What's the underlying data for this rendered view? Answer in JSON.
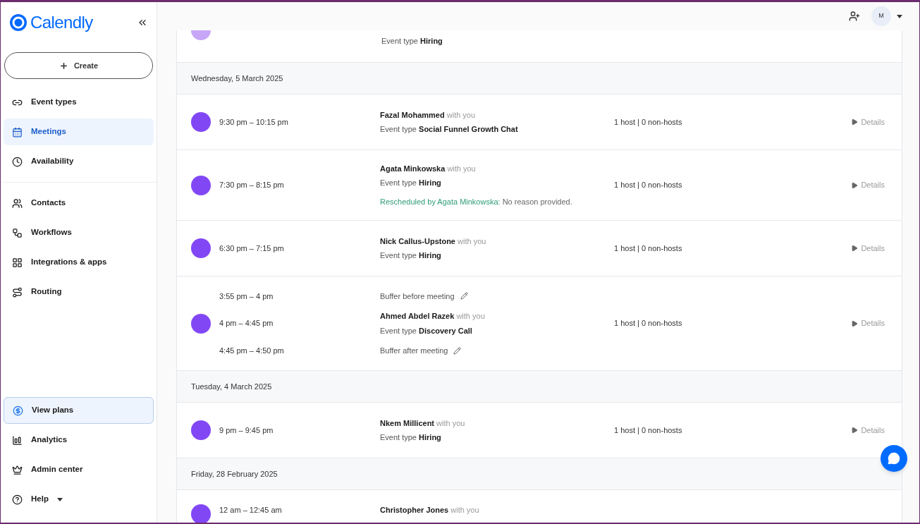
{
  "sidebar": {
    "logo": "Calendly",
    "create_button": "Create",
    "groups": [
      [
        {
          "label": "Event types",
          "selected": false
        },
        {
          "label": "Meetings",
          "selected": true
        },
        {
          "label": "Availability",
          "selected": false
        }
      ],
      [
        {
          "label": "Contacts",
          "selected": false
        },
        {
          "label": "Workflows",
          "selected": false
        },
        {
          "label": "Integrations & apps",
          "selected": false
        },
        {
          "label": "Routing",
          "selected": false
        }
      ]
    ],
    "view_plans": "View plans",
    "bottom_items": [
      {
        "label": "Analytics",
        "selected": false,
        "dropdown": false
      },
      {
        "label": "Admin center",
        "selected": false,
        "dropdown": false
      },
      {
        "label": "Help",
        "selected": false,
        "dropdown": true
      }
    ]
  },
  "header": {
    "avatar": "M"
  },
  "meetings": [
    {
      "kind": "partial",
      "event_label": "Event type",
      "event_type": "Hiring"
    },
    {
      "kind": "date",
      "label": "Wednesday, 5 March 2025"
    },
    {
      "kind": "meeting",
      "time": "9:30 pm – 10:15 pm",
      "invitee": "Fazal Mohammed",
      "with": "with you",
      "event_label": "Event type",
      "event_type": "Social Funnel Growth Chat",
      "hosts": "1 host | 0 non-hosts",
      "details": "Details"
    },
    {
      "kind": "meeting",
      "time": "7:30 pm – 8:15 pm",
      "invitee": "Agata Minkowska",
      "with": "with you",
      "event_label": "Event type",
      "event_type": "Hiring",
      "note_label": "Rescheduled by Agata Minkowska:",
      "note_text": "No reason provided.",
      "hosts": "1 host | 0 non-hosts",
      "details": "Details"
    },
    {
      "kind": "meeting",
      "time": "6:30 pm – 7:15 pm",
      "invitee": "Nick Callus-Upstone",
      "with": "with you",
      "event_label": "Event type",
      "event_type": "Hiring",
      "hosts": "1 host | 0 non-hosts",
      "details": "Details"
    },
    {
      "kind": "meeting",
      "time": "4 pm – 4:45 pm",
      "invitee": "Ahmed Abdel Razek",
      "with": "with you",
      "event_label": "Event type",
      "event_type": "Discovery Call",
      "hosts": "1 host | 0 non-hosts",
      "details": "Details",
      "buffer_before": {
        "time": "3:55 pm – 4 pm",
        "label": "Buffer before meeting"
      },
      "buffer_after": {
        "time": "4:45 pm – 4:50 pm",
        "label": "Buffer after meeting"
      }
    },
    {
      "kind": "date",
      "label": "Tuesday, 4 March 2025"
    },
    {
      "kind": "meeting",
      "time": "9 pm – 9:45 pm",
      "invitee": "Nkem Millicent",
      "with": "with you",
      "event_label": "Event type",
      "event_type": "Hiring",
      "hosts": "1 host | 0 non-hosts",
      "details": "Details"
    },
    {
      "kind": "date",
      "label": "Friday, 28 February 2025"
    },
    {
      "kind": "meeting",
      "time": "12 am – 12:45 am",
      "invitee": "Christopher Jones",
      "with": "with you"
    }
  ]
}
